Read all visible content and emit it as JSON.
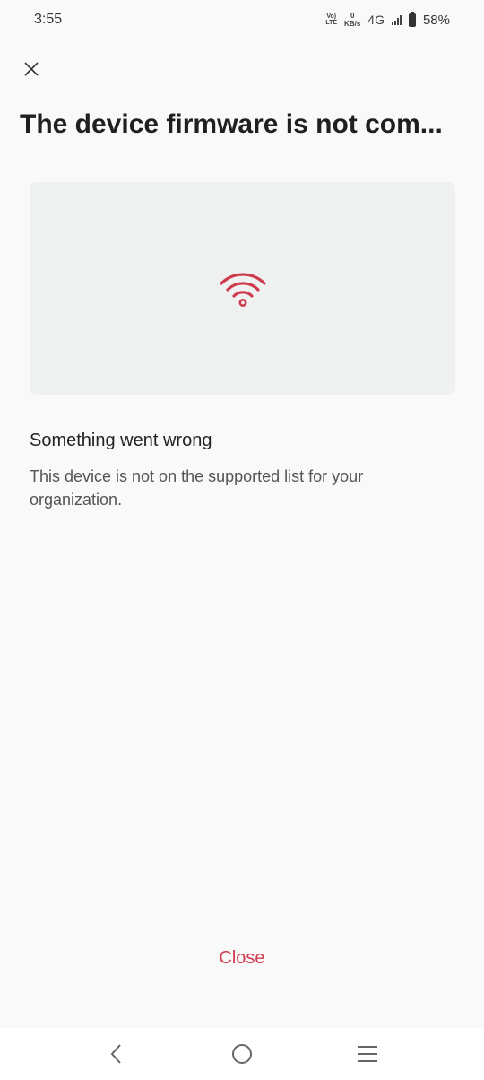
{
  "status_bar": {
    "time": "3:55",
    "volte_top": "Vo)",
    "volte_bottom": "LTE",
    "speed_value": "0",
    "speed_unit": "KB/s",
    "network": "4G",
    "battery": "58%"
  },
  "page": {
    "title": "The device firmware is not com...",
    "heading": "Something went wrong",
    "description": "This device is not on the supported list for your organization.",
    "close_label": "Close"
  },
  "colors": {
    "accent": "#cf3a4c",
    "hero_bg": "#eff1f0",
    "page_bg": "#f9f9f9"
  },
  "icons": {
    "close": "close-icon",
    "hero": "wifi-icon",
    "nav_back": "back-icon",
    "nav_home": "home-icon",
    "nav_recents": "recents-icon"
  }
}
